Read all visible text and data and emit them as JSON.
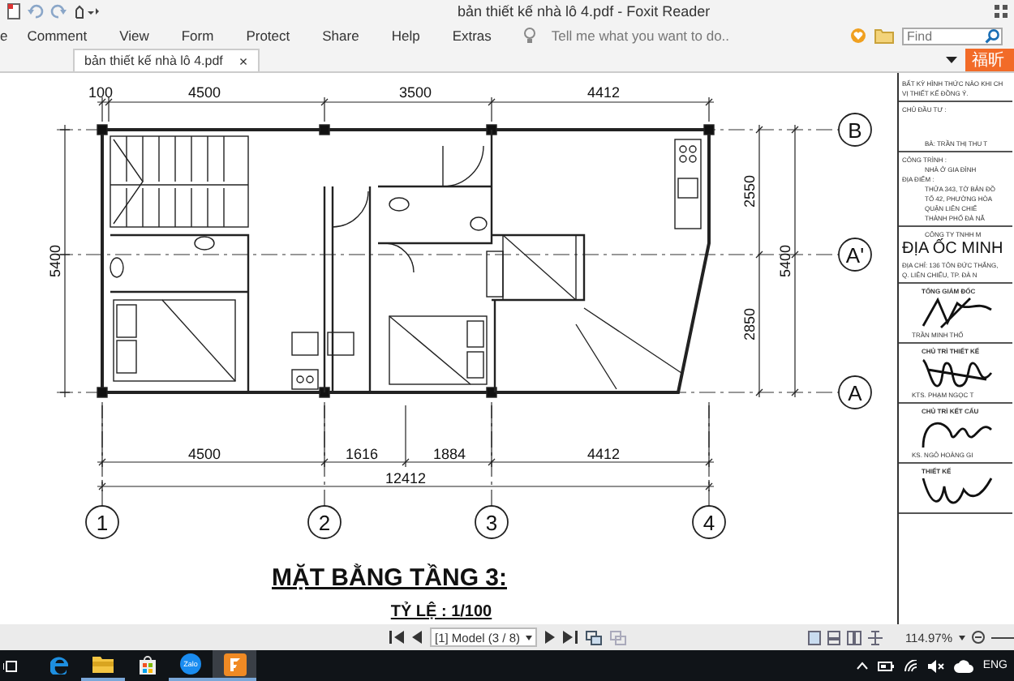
{
  "window": {
    "title": "bản thiết kế nhà lô 4.pdf - Foxit Reader"
  },
  "menu": [
    {
      "label": "e"
    },
    {
      "label": "Comment"
    },
    {
      "label": "View"
    },
    {
      "label": "Form"
    },
    {
      "label": "Protect"
    },
    {
      "label": "Share"
    },
    {
      "label": "Help"
    },
    {
      "label": "Extras"
    }
  ],
  "tell_me": {
    "placeholder": "Tell me what you want to do.."
  },
  "find": {
    "placeholder": "Find"
  },
  "tabs": [
    {
      "label": "bản thiết kế nhà lô 4.pdf",
      "selected": true,
      "close": "×"
    }
  ],
  "promo_button": "福昕",
  "plan": {
    "top_dims": [
      "100",
      "4500",
      "3500",
      "4412"
    ],
    "bottom_dims": [
      "4500",
      "1616",
      "1884",
      "4412"
    ],
    "total": "12412",
    "left_dim": "5400",
    "right_dims": [
      "2550",
      "2850"
    ],
    "right_total": "5400",
    "row_axes": [
      "B",
      "A'",
      "A"
    ],
    "column_axes": [
      "1",
      "2",
      "3",
      "4"
    ],
    "title": "MẶT BẰNG TẦNG 3:",
    "scale": "TỶ LỆ : 1/100"
  },
  "title_block": [
    {
      "lines": [
        {
          "kind": "note",
          "text": "BẤT KỲ HÌNH THỨC NÀO KHI CH"
        },
        {
          "kind": "note",
          "text": "VỊ THIẾT KẾ ĐỒNG Ý."
        }
      ]
    },
    {
      "lines": [
        {
          "kind": "label",
          "text": "CHỦ ĐẦU TƯ :"
        },
        {
          "kind": "gap"
        },
        {
          "kind": "value",
          "text": "BÀ: TRẦN THỊ THU T"
        }
      ]
    },
    {
      "lines": [
        {
          "kind": "label",
          "text": "CÔNG TRÌNH :"
        },
        {
          "kind": "value",
          "text": "NHÀ Ở GIA ĐÌNH"
        },
        {
          "kind": "label",
          "text": "ĐỊA ĐIỂM :"
        },
        {
          "kind": "value",
          "text": "THỬA 343, TỜ BẢN ĐỒ"
        },
        {
          "kind": "value",
          "text": "TỔ 42, PHƯỜNG HÒA"
        },
        {
          "kind": "value",
          "text": "QUẬN LIÊN CHIỂ"
        },
        {
          "kind": "value",
          "text": "THÀNH PHỐ ĐÀ NẴ"
        }
      ]
    },
    {
      "lines": [
        {
          "kind": "value",
          "text": "CÔNG TY TNHH M"
        },
        {
          "kind": "brand",
          "text": "ĐỊA ỐC MINH"
        },
        {
          "kind": "note",
          "text": "ĐỊA CHỈ: 136 TÔN ĐỨC THẮNG,"
        },
        {
          "kind": "note",
          "text": "Q. LIÊN CHIỂU, TP. ĐÀ N"
        }
      ]
    },
    {
      "lines": [
        {
          "kind": "role",
          "text": "TỔNG GIÁM ĐỐC"
        },
        {
          "kind": "signature"
        },
        {
          "kind": "name",
          "text": "TRẦN MINH THỐ"
        }
      ]
    },
    {
      "lines": [
        {
          "kind": "role",
          "text": "CHỦ TRÌ THIẾT KẾ"
        },
        {
          "kind": "signature"
        },
        {
          "kind": "name",
          "text": "KTS. PHẠM NGỌC T"
        }
      ]
    },
    {
      "lines": [
        {
          "kind": "role",
          "text": "CHỦ TRÌ KẾT CẤU"
        },
        {
          "kind": "signature"
        },
        {
          "kind": "name",
          "text": "KS. NGÔ HOÀNG GI"
        }
      ]
    },
    {
      "lines": [
        {
          "kind": "role",
          "text": "THIẾT KẾ"
        },
        {
          "kind": "signature"
        }
      ]
    }
  ],
  "status_bar": {
    "page": "[1] Model (3 / 8)",
    "zoom": "114.97%"
  },
  "taskbar": {
    "language": "ENG",
    "apps": [
      {
        "kind": "edge",
        "running": false,
        "active": false
      },
      {
        "kind": "explorer",
        "running": true,
        "active": false
      },
      {
        "kind": "store",
        "running": false,
        "active": false
      },
      {
        "kind": "zalo",
        "label": "Zalo",
        "running": true,
        "active": false
      },
      {
        "kind": "foxit",
        "running": true,
        "active": true
      }
    ]
  }
}
